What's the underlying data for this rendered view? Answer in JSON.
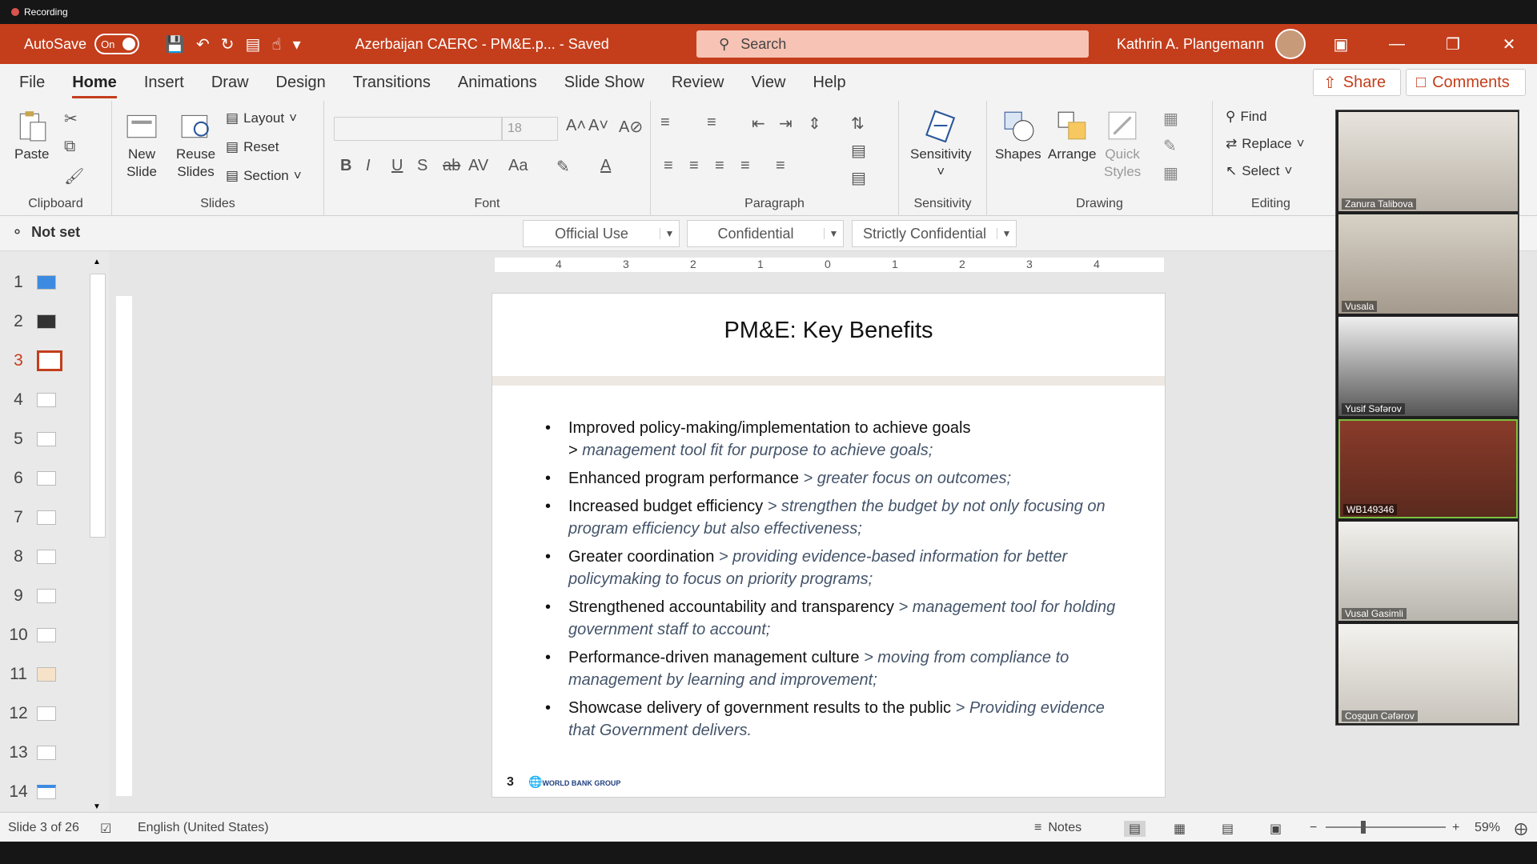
{
  "recording": {
    "label": "Recording"
  },
  "titlebar": {
    "autosave_label": "AutoSave",
    "autosave_state": "On",
    "doc_title": "Azerbaijan CAERC - PM&E.p...  -  Saved",
    "search_placeholder": "Search",
    "user_name": "Kathrin A. Plangemann"
  },
  "menu": {
    "tabs": [
      "File",
      "Home",
      "Insert",
      "Draw",
      "Design",
      "Transitions",
      "Animations",
      "Slide Show",
      "Review",
      "View",
      "Help"
    ],
    "share": "Share",
    "comments": "Comments"
  },
  "ribbon": {
    "clipboard": {
      "label": "Clipboard",
      "paste": "Paste"
    },
    "slides": {
      "label": "Slides",
      "new_slide_1": "New",
      "new_slide_2": "Slide",
      "reuse_1": "Reuse",
      "reuse_2": "Slides",
      "layout": "Layout",
      "reset": "Reset",
      "section": "Section"
    },
    "font": {
      "label": "Font",
      "size": "18"
    },
    "paragraph": {
      "label": "Paragraph"
    },
    "sensitivity": {
      "label": "Sensitivity",
      "button": "Sensitivity"
    },
    "drawing": {
      "label": "Drawing",
      "shapes": "Shapes",
      "arrange": "Arrange",
      "quick_1": "Quick",
      "quick_2": "Styles"
    },
    "editing": {
      "label": "Editing",
      "find": "Find",
      "replace": "Replace",
      "select": "Select"
    }
  },
  "sensbar": {
    "notset": "Not set",
    "official": "Official Use",
    "confidential": "Confidential",
    "strict": "Strictly Confidential"
  },
  "thumbs": [
    "1",
    "2",
    "3",
    "4",
    "5",
    "6",
    "7",
    "8",
    "9",
    "10",
    "11",
    "12",
    "13",
    "14"
  ],
  "ruler": {
    "h": [
      "4",
      "3",
      "2",
      "1",
      "0",
      "1",
      "2",
      "3",
      "4"
    ]
  },
  "slide": {
    "title": "PM&E: Key Benefits",
    "bullets": [
      {
        "main": "Improved policy-making/implementation to achieve goals",
        "sub_prefix": "> ",
        "sub": "management tool fit for purpose to achieve goals;"
      },
      {
        "main": "Enhanced program performance ",
        "sub": "> greater focus on outcomes;"
      },
      {
        "main": "Increased budget efficiency ",
        "sub": "> strengthen the budget by not only focusing on program efficiency but also effectiveness;"
      },
      {
        "main": "Greater coordination ",
        "sub": "> providing evidence-based information for better policymaking to focus on priority programs;"
      },
      {
        "main": "Strengthened accountability and transparency ",
        "sub": "> management tool for holding government staff to account;"
      },
      {
        "main": "Performance-driven management culture ",
        "sub": "> moving from compliance to management by learning and improvement;"
      },
      {
        "main": "Showcase delivery of government results to the public ",
        "sub": "> Providing evidence that Government delivers."
      }
    ],
    "page_number": "3",
    "logo_text": "WORLD BANK GROUP"
  },
  "participants": [
    "Zanura Talibova",
    "Vusala",
    "Yusif Səfərov",
    "WB149346",
    "Vusal Gasimli",
    "Coşqun Cəfərov"
  ],
  "status": {
    "slide": "Slide 3 of 26",
    "language": "English (United States)",
    "notes": "Notes",
    "zoom": "59%",
    "zoom_level": 0.59
  }
}
